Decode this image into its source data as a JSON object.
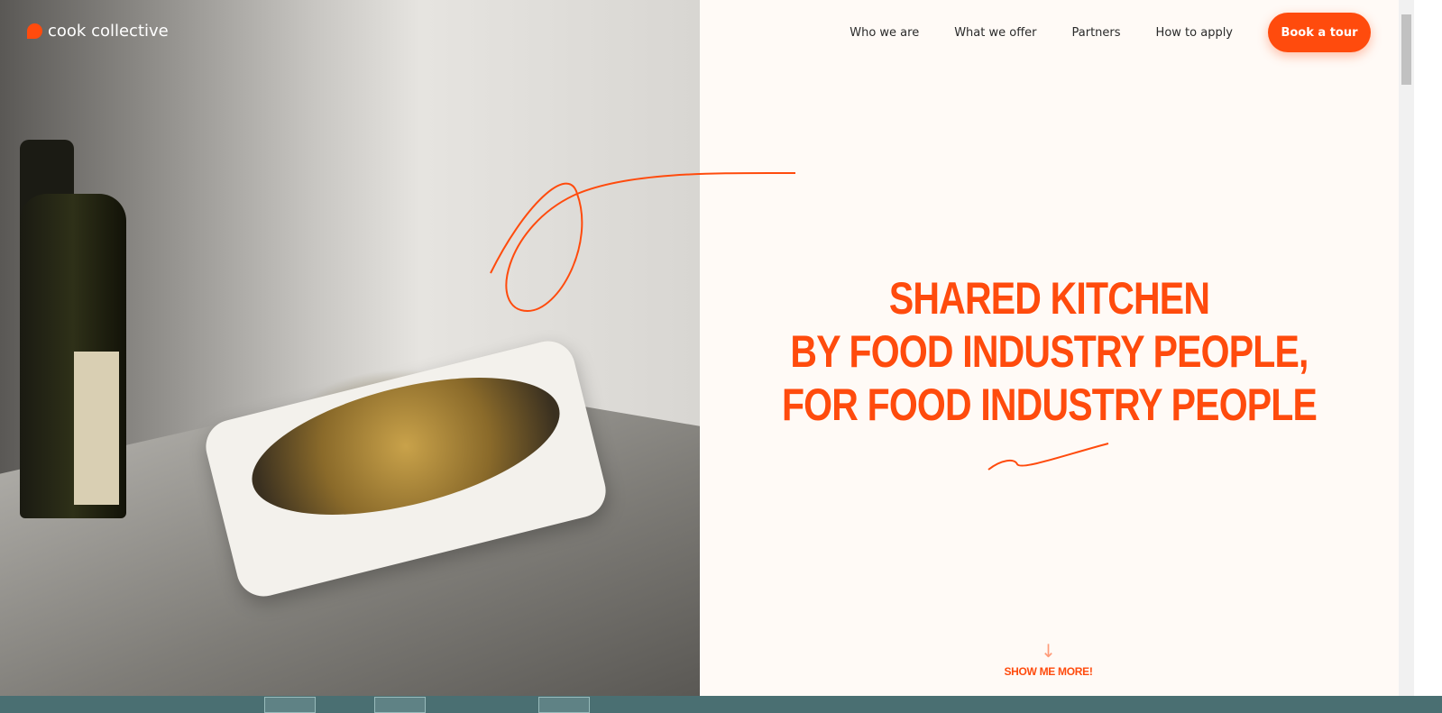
{
  "brand": {
    "name": "cook collective",
    "accent": "#ff4b0d"
  },
  "nav": {
    "items": [
      "Who we are",
      "What we offer",
      "Partners",
      "How to apply"
    ],
    "cta": "Book a tour"
  },
  "hero": {
    "lines": [
      "SHARED KITCHEN",
      "BY FOOD INDUSTRY PEOPLE,",
      "FOR FOOD INDUSTRY PEOPLE"
    ],
    "show_more": "SHOW ME MORE!"
  }
}
